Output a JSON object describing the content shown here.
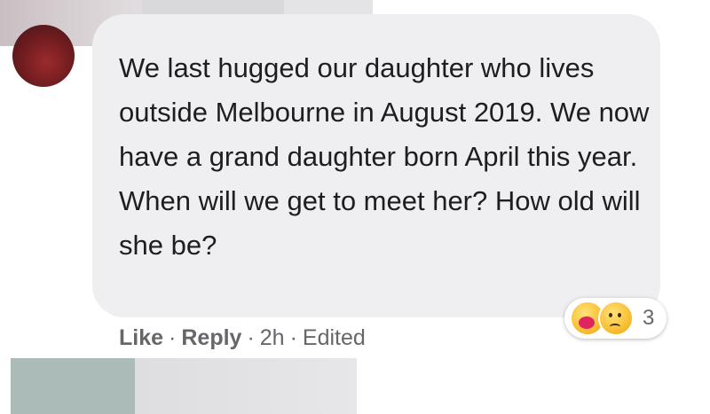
{
  "comment": {
    "text": "We last hugged our daughter who lives outside Melbourne in August 2019. We now have a grand daughter born April this year. When will we get to meet her? How old will she be?",
    "reactions": {
      "icons": [
        "care-icon",
        "sad-icon"
      ],
      "count": "3"
    },
    "actions": {
      "like": "Like",
      "reply": "Reply",
      "time": "2h",
      "edited": "Edited",
      "separator": "·"
    }
  },
  "colors": {
    "bubble": "#efeff2",
    "text": "#1c1e21",
    "meta": "#65676b"
  }
}
